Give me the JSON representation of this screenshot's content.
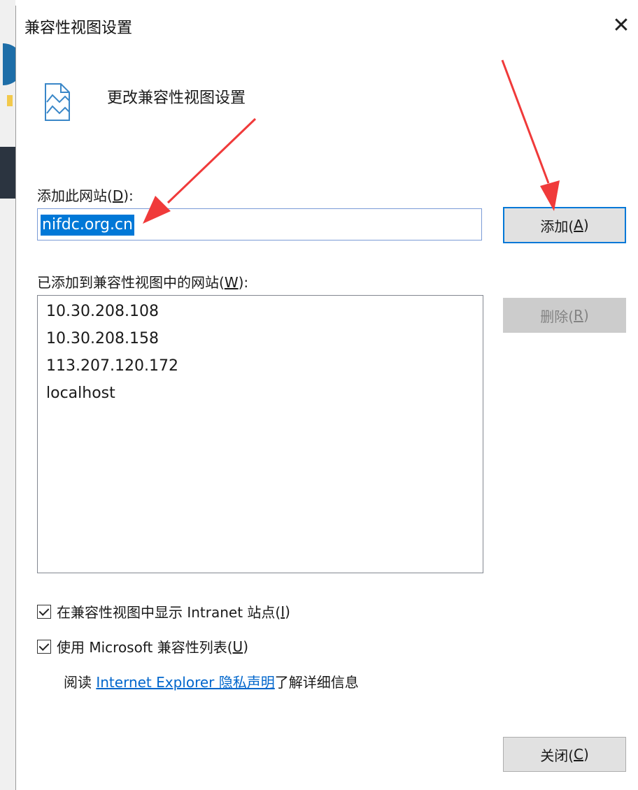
{
  "dialog": {
    "title": "兼容性视图设置",
    "close_glyph": "✕",
    "header_text": "更改兼容性视图设置"
  },
  "add_site": {
    "label_prefix": "添加此网站(",
    "label_key": "D",
    "label_suffix": "):",
    "input_value": "nifdc.org.cn",
    "add_button_prefix": "添加(",
    "add_button_key": "A",
    "add_button_suffix": ")"
  },
  "site_list": {
    "label_prefix": "已添加到兼容性视图中的网站(",
    "label_key": "W",
    "label_suffix": "):",
    "items": [
      "10.30.208.108",
      "10.30.208.158",
      "113.207.120.172",
      "localhost"
    ],
    "remove_button_prefix": "删除(",
    "remove_button_key": "R",
    "remove_button_suffix": ")"
  },
  "options": {
    "intranet": {
      "checked": true,
      "prefix": "在兼容性视图中显示 Intranet 站点(",
      "key": "I",
      "suffix": ")"
    },
    "microsoft_list": {
      "checked": true,
      "prefix": "使用 Microsoft 兼容性列表(",
      "key": "U",
      "suffix": ")"
    }
  },
  "privacy": {
    "prefix": "阅读 ",
    "link": "Internet Explorer 隐私声明",
    "suffix": "了解详细信息"
  },
  "close_button": {
    "prefix": "关闭(",
    "key": "C",
    "suffix": ")"
  },
  "colors": {
    "accent": "#0078d7",
    "annotation_arrow": "#f03a3a",
    "link": "#0066cc"
  }
}
